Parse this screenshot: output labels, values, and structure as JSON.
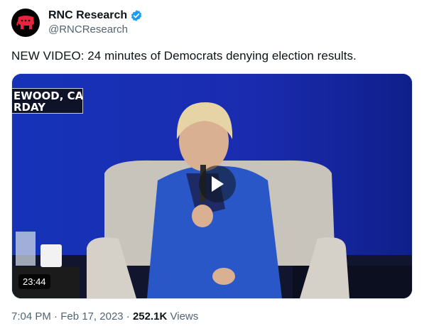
{
  "author": {
    "name": "RNC Research",
    "handle": "@RNCResearch",
    "verified": true,
    "avatar_icon": "elephant-logo-icon",
    "avatar_color": "#000000",
    "logo_color": "#e8243c"
  },
  "tweet": {
    "text": "NEW VIDEO: 24 minutes of Democrats denying election results."
  },
  "media": {
    "type": "video",
    "overlay_text": "EWOOD, CA\nRDAY",
    "duration": "23:44",
    "play_icon": "play-icon",
    "background_color": "#1a2fb0"
  },
  "meta": {
    "time": "7:04 PM",
    "date": "Feb 17, 2023",
    "separator": "·",
    "views_count": "252.1K",
    "views_label": "Views"
  },
  "colors": {
    "text": "#0f1419",
    "secondary": "#536471",
    "verified": "#1d9bf0"
  }
}
